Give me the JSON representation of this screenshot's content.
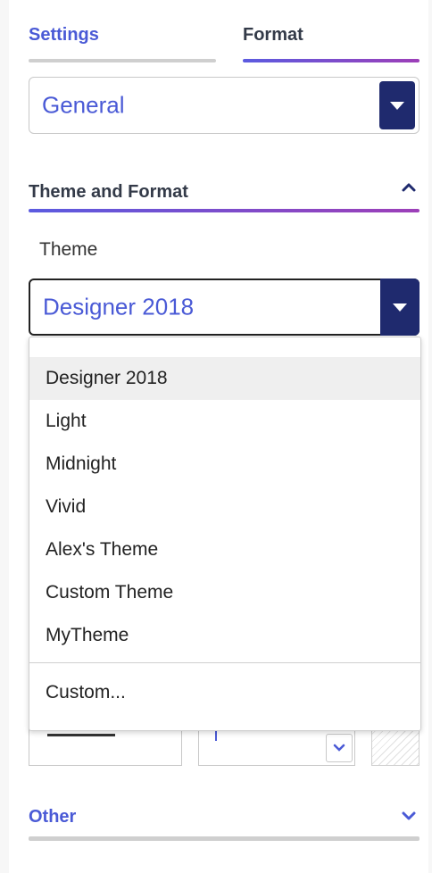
{
  "tabs": {
    "settings": "Settings",
    "format": "Format"
  },
  "general_select": {
    "value": "General"
  },
  "theme_section": {
    "title": "Theme and Format",
    "theme_label": "Theme",
    "selected_theme": "Designer 2018",
    "options": [
      "Designer 2018",
      "Light",
      "Midnight",
      "Vivid",
      "Alex's Theme",
      "Custom Theme",
      "MyTheme"
    ],
    "custom_option": "Custom..."
  },
  "other_section": {
    "title": "Other"
  },
  "colors": {
    "accent": "#4a5ad6",
    "dropdown_button": "#1f2a6e",
    "gradient_start": "#5b5be0",
    "gradient_end": "#9d3fb8"
  }
}
